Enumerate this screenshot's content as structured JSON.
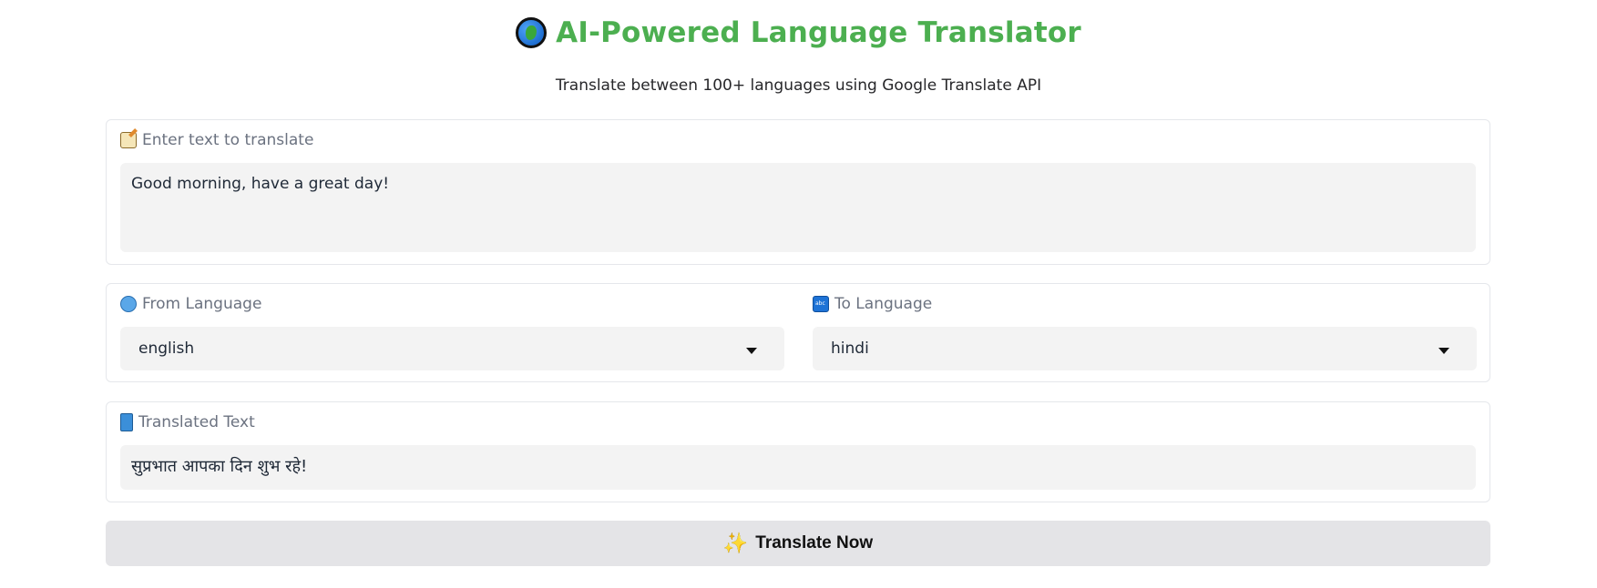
{
  "header": {
    "icon": "globe-icon",
    "title": "AI-Powered Language Translator",
    "subtitle": "Translate between 100+ languages using Google Translate API"
  },
  "input_section": {
    "icon": "memo-icon",
    "label": "Enter text to translate",
    "value": "Good morning, have a great day!"
  },
  "language_section": {
    "from": {
      "icon": "globe-with-meridians-icon",
      "label": "From Language",
      "value": "english"
    },
    "to": {
      "icon": "abc-input-icon",
      "label": "To Language",
      "value": "hindi"
    }
  },
  "output_section": {
    "icon": "book-icon",
    "label": "Translated Text",
    "value": "सुप्रभात आपका दिन शुभ रहे!"
  },
  "action": {
    "icon": "sparkles-icon",
    "label": "Translate Now"
  },
  "colors": {
    "title": "#4caf50",
    "field_background": "#f3f3f3",
    "button_background": "#e4e4e7"
  }
}
